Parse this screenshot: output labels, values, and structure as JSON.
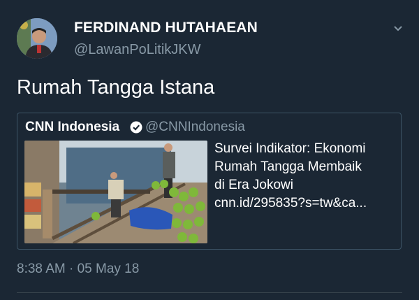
{
  "author": {
    "name": "FERDINAND HUTAHAEAN",
    "handle": "@LawanPoLitikJKW"
  },
  "tweet": {
    "text": "Rumah Tangga Istana",
    "timestamp": "8:38 AM · 05 May 18"
  },
  "quoted": {
    "name": "CNN Indonesia",
    "handle": "@CNNIndonesia",
    "verified": true,
    "card": {
      "title_lines": [
        "Survei Indikator: Ekonomi",
        "Rumah Tangga Membaik",
        "di Era Jokowi"
      ],
      "link": "cnn.id/295835?s=tw&ca..."
    }
  },
  "icons": {
    "menu": "chevron-down-icon",
    "verified": "verified-badge-icon"
  },
  "colors": {
    "background": "#1b2734",
    "secondary_text": "#8899a6",
    "border": "#3d5466"
  }
}
